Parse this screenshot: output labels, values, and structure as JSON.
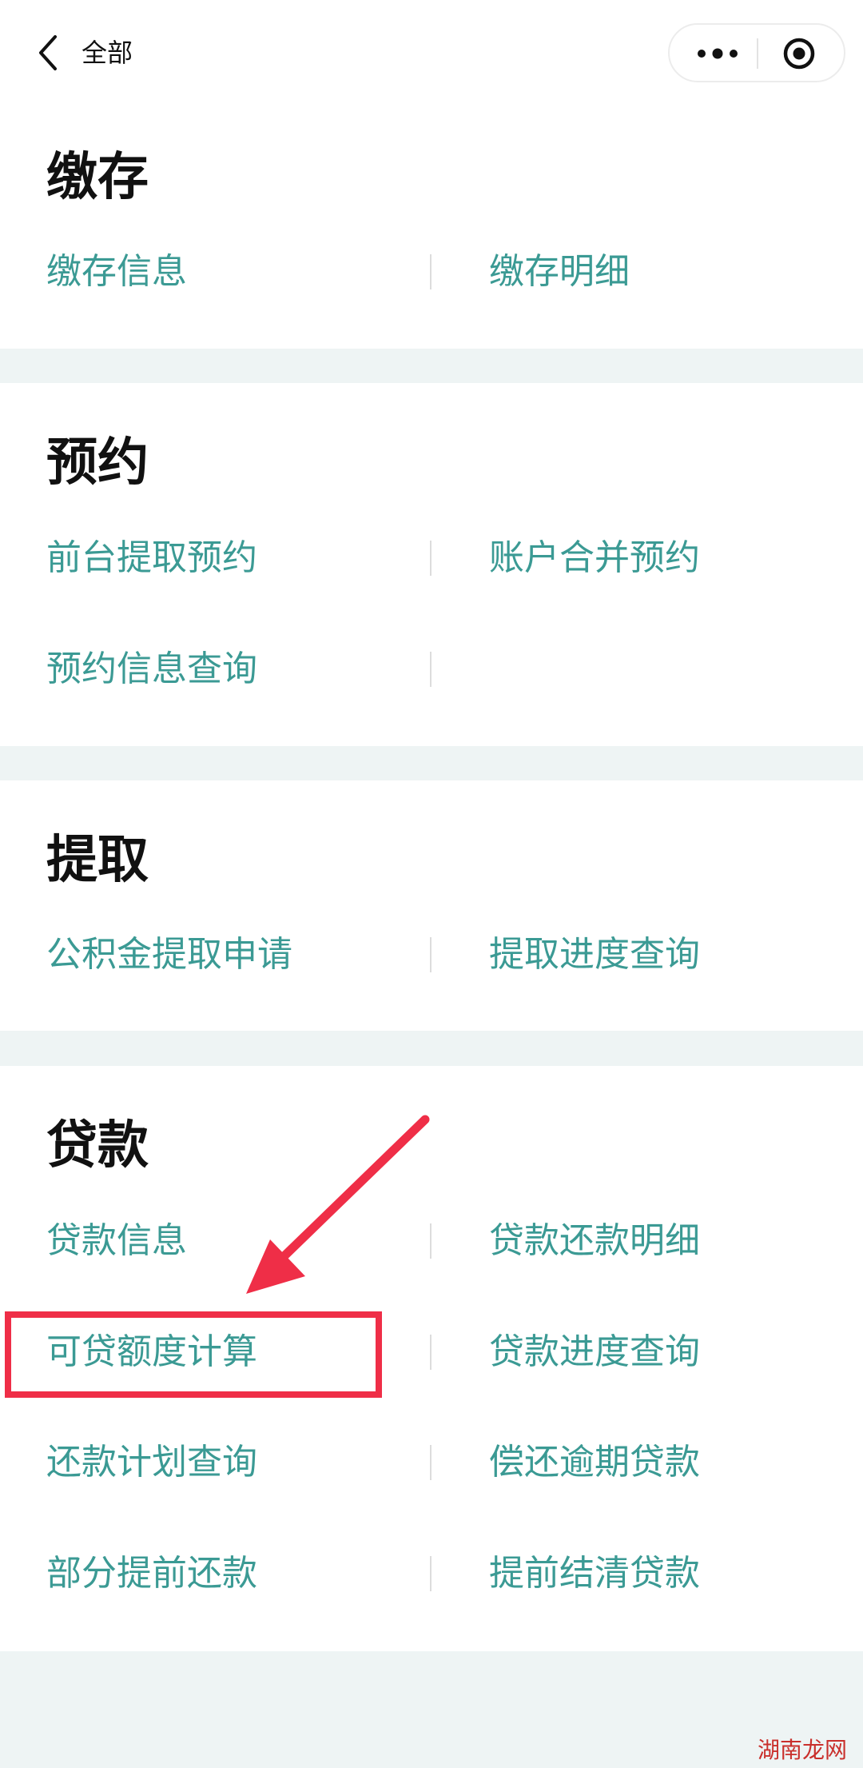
{
  "nav": {
    "title": "全部",
    "back_icon": "chevron-left-icon",
    "more_icon": "more-dots-icon",
    "close_icon": "target-circle-icon"
  },
  "sections": [
    {
      "title": "缴存",
      "items": [
        "缴存信息",
        "缴存明细"
      ]
    },
    {
      "title": "预约",
      "items": [
        "前台提取预约",
        "账户合并预约",
        "预约信息查询"
      ]
    },
    {
      "title": "提取",
      "items": [
        "公积金提取申请",
        "提取进度查询"
      ]
    },
    {
      "title": "贷款",
      "items": [
        "贷款信息",
        "贷款还款明细",
        "可贷额度计算",
        "贷款进度查询",
        "还款计划查询",
        "偿还逾期贷款",
        "部分提前还款",
        "提前结清贷款"
      ]
    }
  ],
  "annotation": {
    "highlight_color": "#ef2e47",
    "highlighted_item": "可贷额度计算"
  },
  "watermark": "湖南龙网",
  "colors": {
    "link": "#3b9a94",
    "background": "#eef4f4"
  }
}
